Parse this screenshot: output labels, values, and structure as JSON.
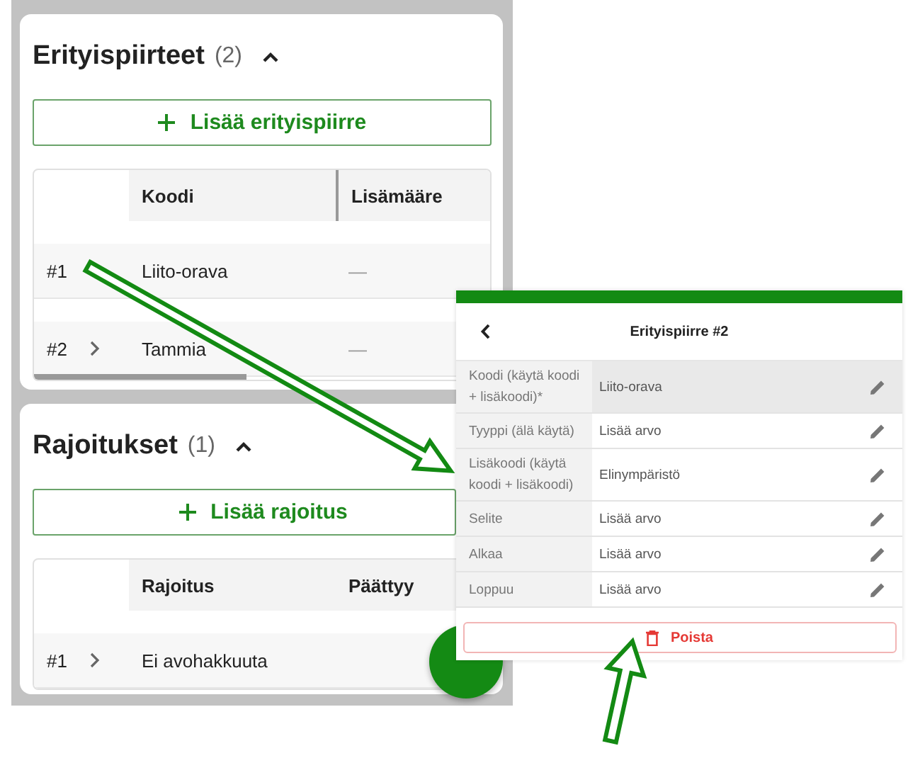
{
  "sections": [
    {
      "title": "Erityispiirteet",
      "count": "(2)",
      "expanded": true,
      "add_button": "Lisää erityispiirre",
      "columns": [
        "Koodi",
        "Lisämääre"
      ],
      "rows": [
        {
          "index": "#1",
          "expandable": false,
          "cells": [
            "Liito-orava",
            "—"
          ]
        },
        {
          "index": "#2",
          "expandable": true,
          "cells": [
            "Tammia",
            "—"
          ]
        }
      ]
    },
    {
      "title": "Rajoitukset",
      "count": "(1)",
      "expanded": true,
      "add_button": "Lisää rajoitus",
      "columns": [
        "Rajoitus",
        "Päättyy"
      ],
      "rows": [
        {
          "index": "#1",
          "expandable": true,
          "cells": [
            "Ei avohakkuuta"
          ]
        }
      ]
    }
  ],
  "detail_panel": {
    "title": "Erityispiirre #2",
    "fields": [
      {
        "label": "Koodi (käytä koodi + lisäkoodi)*",
        "value": "Liito-orava",
        "selected": true
      },
      {
        "label": "Tyyppi (älä käytä)",
        "value": "Lisää arvo",
        "selected": false
      },
      {
        "label": "Lisäkoodi (käytä koodi + lisäkoodi)",
        "value": "Elinympäristö",
        "selected": false
      },
      {
        "label": "Selite",
        "value": "Lisää arvo",
        "selected": false
      },
      {
        "label": "Alkaa",
        "value": "Lisää arvo",
        "selected": false
      },
      {
        "label": "Loppuu",
        "value": "Lisää arvo",
        "selected": false
      }
    ],
    "delete_button": "Poista"
  }
}
